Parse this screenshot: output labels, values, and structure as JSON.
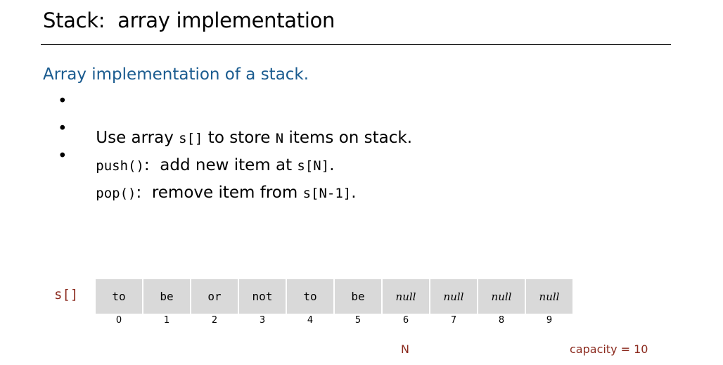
{
  "slide": {
    "title": "Stack:  array implementation",
    "subtitle": "Array implementation of a stack."
  },
  "bullets": [
    {
      "bullet": "•",
      "parts": [
        "Use array ",
        "s[]",
        " to store ",
        "N",
        " items on stack."
      ]
    },
    {
      "bullet": "•",
      "parts": [
        "push()",
        ":  add new item at ",
        "s[N]",
        "."
      ]
    },
    {
      "bullet": "•",
      "parts": [
        "pop()",
        ":  remove item from ",
        "s[N-1]",
        "."
      ]
    }
  ],
  "array": {
    "label": "s[]",
    "cells": [
      "to",
      "be",
      "or",
      "not",
      "to",
      "be",
      "null",
      "null",
      "null",
      "null"
    ],
    "indices": [
      "0",
      "1",
      "2",
      "3",
      "4",
      "5",
      "6",
      "7",
      "8",
      "9"
    ],
    "n_label": "N",
    "capacity_label": "capacity = 10"
  },
  "colors": {
    "subtitle": "#1a5b8f",
    "annotation": "#8b2a1e",
    "cell_fill": "#d9d9d9"
  }
}
